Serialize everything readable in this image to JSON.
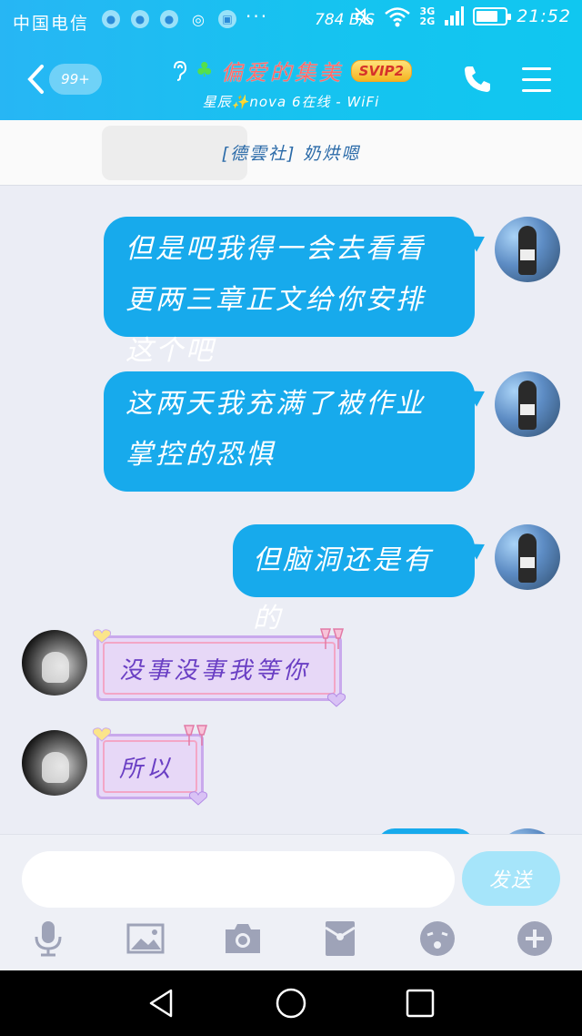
{
  "status_bar": {
    "carrier": "中国电信",
    "more": "···",
    "speed": "784 B/S",
    "network_top": "3G",
    "network_bottom": "2G",
    "time": "21:52",
    "battery_level": 0.75
  },
  "header": {
    "unread_badge": "99+",
    "title": "偏爱的集美",
    "badge": "SVIP2",
    "subtitle": "星辰✨nova 6在线 - WiFi"
  },
  "pinned_notice": "[德雲社] 奶烘嗯",
  "messages": [
    {
      "sender": "me",
      "text": "但是吧我得一会去看看更两三章正文给你安排这个吧"
    },
    {
      "sender": "me",
      "text": "这两天我充满了被作业掌控的恐惧"
    },
    {
      "sender": "me",
      "text": "但脑洞还是有的"
    },
    {
      "sender": "other",
      "text": "没事没事我等你"
    },
    {
      "sender": "other",
      "text": "所以"
    }
  ],
  "composer": {
    "input_value": "",
    "input_placeholder": "",
    "send_label": "发送"
  },
  "toolbar": [
    "microphone-icon",
    "image-icon",
    "camera-icon",
    "red-packet-icon",
    "emoji-icon",
    "plus-icon"
  ],
  "colors": {
    "accent": "#17aaec",
    "purple_bubble": "#e7d8f7"
  }
}
